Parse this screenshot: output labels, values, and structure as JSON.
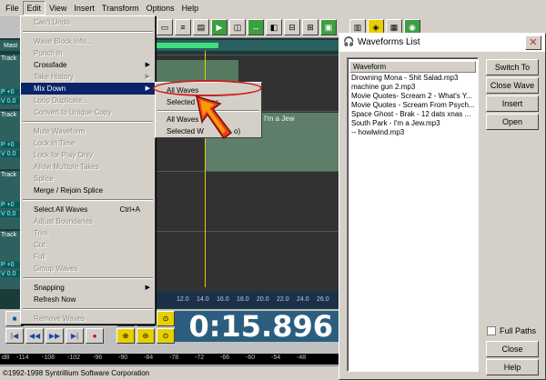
{
  "menubar": {
    "items": [
      "File",
      "Edit",
      "View",
      "Insert",
      "Transform",
      "Options",
      "Help"
    ]
  },
  "edit_menu": {
    "can_undo": "Can't Undo",
    "wave_block_info": "Wave Block Info...",
    "punch_in": "Punch In",
    "crossfade": "Crossfade",
    "take_history": "Take History",
    "mix_down": "Mix Down",
    "loop_duplicate": "Loop Duplicate...",
    "convert_unique": "Convert to Unique Copy",
    "mute_waveform": "Mute Waveform",
    "lock_in_time": "Lock In Time",
    "lock_play_only": "Lock for Play Only",
    "allow_multiple_takes": "Allow Multiple Takes",
    "splice": "Splice",
    "merge_rejoin": "Merge / Rejoin Splice",
    "select_all_waves": "Select All Waves",
    "select_all_shortcut": "Ctrl+A",
    "adjust_boundaries": "Adjust Boundaries",
    "trim": "Trim",
    "cut": "Cut",
    "full": "Full",
    "group_waves": "Group Waves",
    "snapping": "Snapping",
    "refresh_now": "Refresh Now",
    "remove_waves": "Remove Waves"
  },
  "submenu": {
    "all_waves": "All Waves",
    "selected_waves": "Selected Waves",
    "all_waves_partial": "All Waves (",
    "selected_partial": "Selected W",
    "partial_tail": "o)"
  },
  "workarea": {
    "master_label": "Mast",
    "track_label": "Track",
    "pan_label": "P +0",
    "vol_label": "V 0.0",
    "wave_text": "I'm a Jew"
  },
  "timeline": {
    "ticks": [
      "12.0",
      "14.0",
      "16.0",
      "18.0",
      "20.0",
      "22.0",
      "24.0",
      "26.0"
    ]
  },
  "counter": {
    "time": "0:15.896"
  },
  "db_scale": {
    "labels": [
      "dB",
      "-114",
      "-108",
      "-102",
      "-96",
      "-90",
      "-84",
      "-78",
      "-72",
      "-66",
      "-60",
      "-54",
      "-48"
    ]
  },
  "status": {
    "copyright": "©1992-1998 Syntrillium Software Corporation"
  },
  "waveforms_dialog": {
    "title": "Waveforms List",
    "column_header": "Waveform",
    "items": [
      "Drowning Mona - Shit Salad.mp3",
      "machine gun 2.mp3",
      "Movie Quotes- Scream 2 - What's Y...",
      "Movie Quotes - Scream From Psych...",
      "Space Ghost - Brak - 12 dats xnas ...",
      "South Park - I'm a Jew.mp3",
      "-- howlwind.mp3"
    ],
    "buttons": {
      "switch_to": "Switch To",
      "close_wave": "Close Wave",
      "insert": "Insert",
      "open": "Open",
      "close": "Close",
      "help": "Help"
    },
    "full_paths": "Full Paths"
  },
  "colors": {
    "menu_highlight": "#0a246a",
    "counter_bg": "#2b5e7e",
    "ring": "#cc2020"
  }
}
